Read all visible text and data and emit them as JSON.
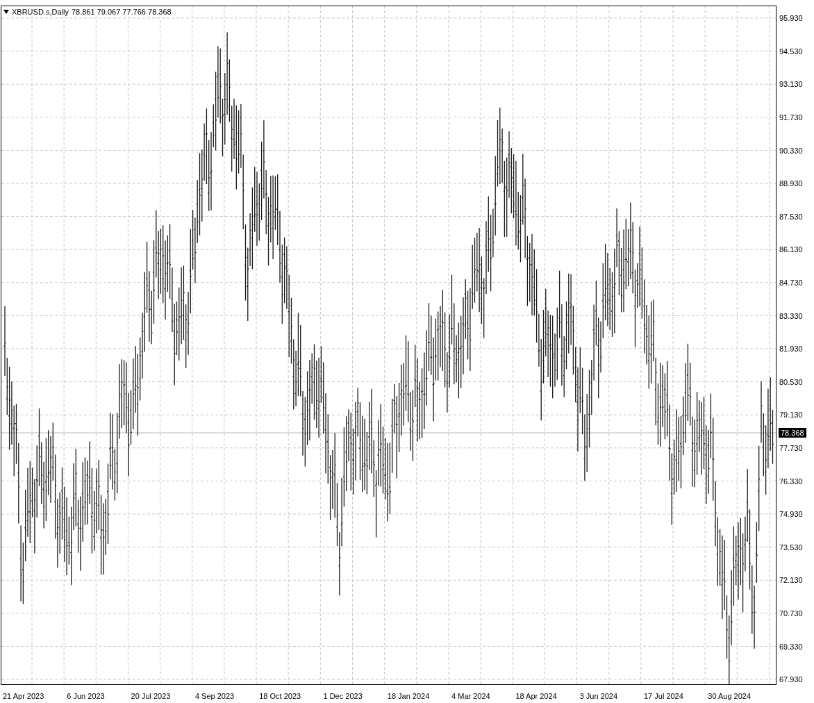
{
  "header": {
    "symbol": "XBRUSD.s,Daily",
    "ohlc": "78.861 79.067 77.766 78.368"
  },
  "price_axis": {
    "labels": [
      "95.930",
      "94.530",
      "93.130",
      "91.730",
      "90.330",
      "88.930",
      "87.530",
      "86.130",
      "84.730",
      "83.330",
      "81.930",
      "80.530",
      "79.130",
      "77.730",
      "76.330",
      "74.930",
      "73.530",
      "72.130",
      "70.730",
      "69.330",
      "67.930"
    ],
    "current_price": "78.368"
  },
  "time_axis": {
    "labels": [
      "21 Apr 2023",
      "6 Jun 2023",
      "20 Jul 2023",
      "4 Sep 2023",
      "18 Oct 2023",
      "1 Dec 2023",
      "18 Jan 2024",
      "4 Mar 2024",
      "18 Apr 2024",
      "3 Jun 2024",
      "17 Jul 2024",
      "30 Aug 2024"
    ]
  }
}
